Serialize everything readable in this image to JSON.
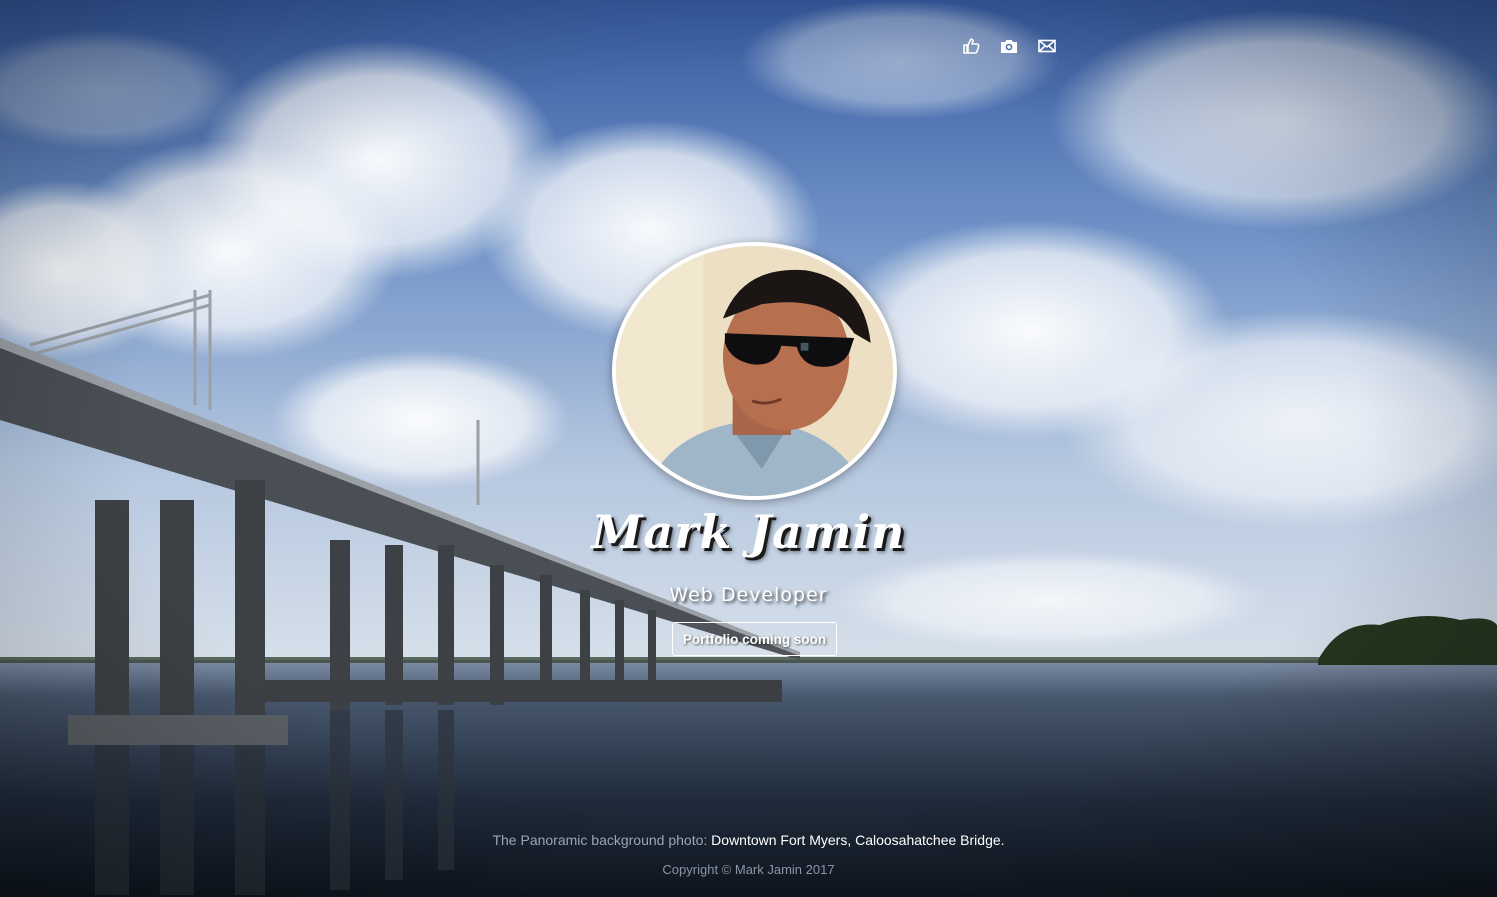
{
  "nav": {
    "icons": [
      "thumbs-up-icon",
      "camera-icon",
      "mail-icon"
    ]
  },
  "profile": {
    "name": "Mark Jamin",
    "role": "Web Developer",
    "cta_label": "Portfolio coming soon"
  },
  "footer": {
    "credit_prefix": "The Panoramic background photo:",
    "credit_link": "Downtown Fort Myers, Caloosahatchee Bridge.",
    "copyright": "Copyright © Mark Jamin 2017"
  },
  "colors": {
    "sky": "#3f64a8",
    "water": "#1c2a3b",
    "text": "#ffffff",
    "muted_text": "#9aa6b6"
  }
}
